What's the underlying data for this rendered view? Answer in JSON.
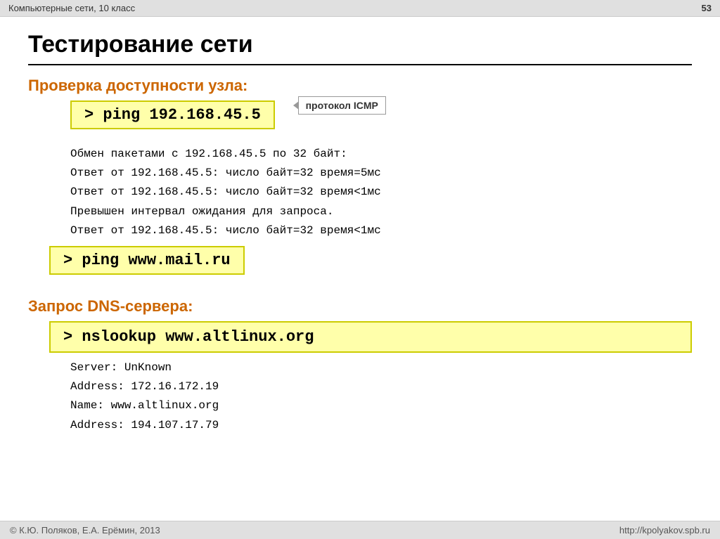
{
  "topbar": {
    "title": "Компьютерные сети, 10 класс",
    "page_number": "53"
  },
  "slide": {
    "title": "Тестирование сети",
    "section1": {
      "heading": "Проверка доступности узла:",
      "command1": "> ping 192.168.45.5",
      "tooltip": "протокол ICMP",
      "output": [
        "Обмен пакетами с 192.168.45.5 по 32 байт:",
        "Ответ от 192.168.45.5: число байт=32 время=5мс",
        "Ответ от 192.168.45.5: число байт=32 время<1мс",
        "Превышен интервал ожидания для запроса.",
        "Ответ от 192.168.45.5: число байт=32 время<1мс"
      ],
      "command2": "> ping www.mail.ru"
    },
    "section2": {
      "heading": "Запрос DNS-сервера:",
      "command": "> nslookup www.altlinux.org",
      "output": [
        {
          "label": "Server:  ",
          "value": "UnKnown"
        },
        {
          "label": "Address: ",
          "value": "172.16.172.19"
        },
        {
          "label": "Name:    ",
          "value": "www.altlinux.org"
        },
        {
          "label": "Address: ",
          "value": "194.107.17.79"
        }
      ]
    }
  },
  "bottombar": {
    "left": "© К.Ю. Поляков, Е.А. Ерёмин, 2013",
    "right": "http://kpolyakov.spb.ru"
  }
}
